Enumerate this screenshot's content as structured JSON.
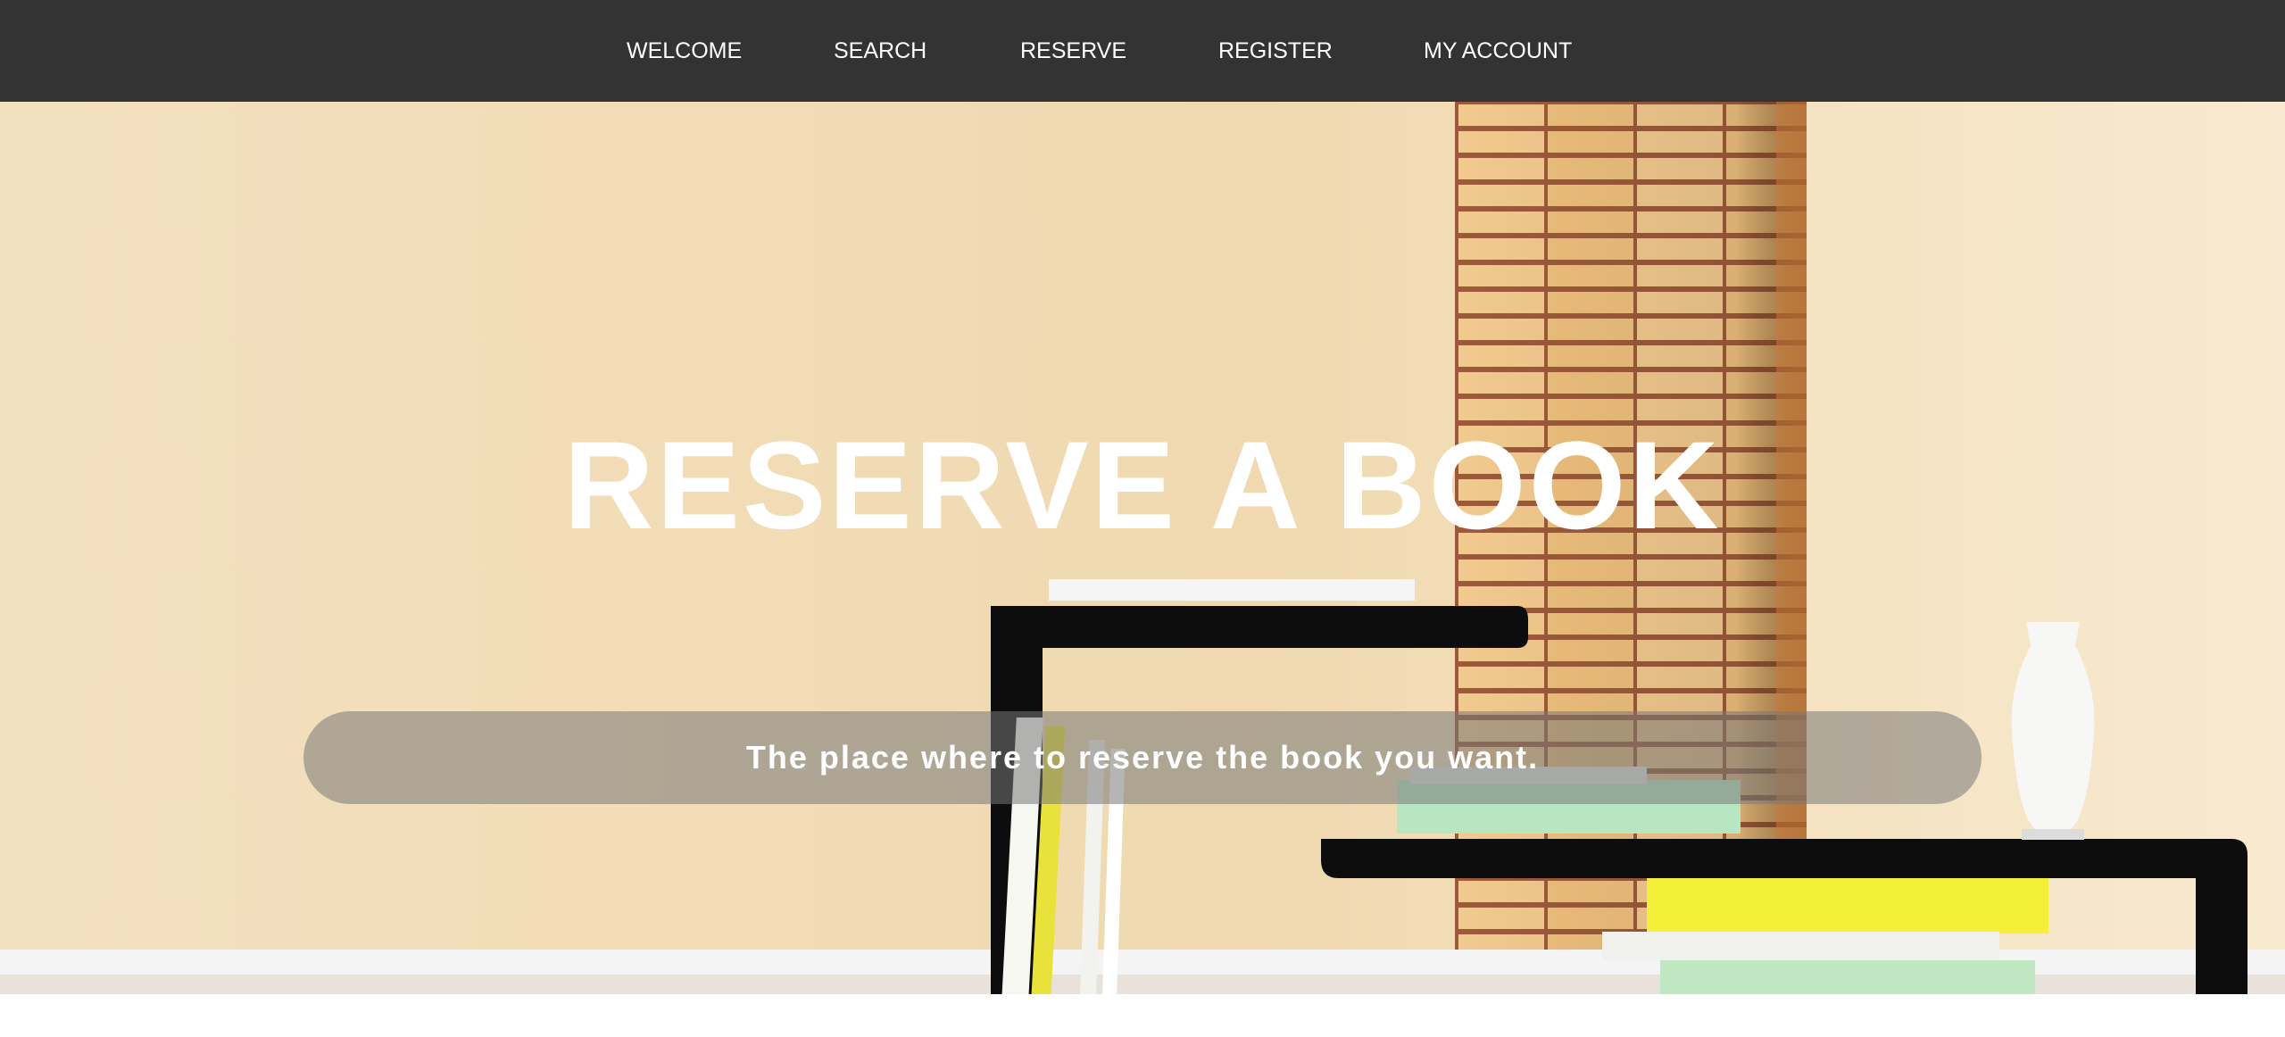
{
  "nav": {
    "items": [
      {
        "label": "WELCOME"
      },
      {
        "label": "SEARCH"
      },
      {
        "label": "RESERVE"
      },
      {
        "label": "REGISTER"
      },
      {
        "label": "MY ACCOUNT"
      }
    ]
  },
  "hero": {
    "title": "RESERVE A BOOK",
    "tagline": "The place where to reserve the book you want.",
    "image_description_icon": "room-with-brick-pillar-and-bookshelf-image"
  },
  "colors": {
    "nav_background": "#333333",
    "nav_text": "#ffffff",
    "wall": "#f2dfbb",
    "shelf": "#111111"
  }
}
